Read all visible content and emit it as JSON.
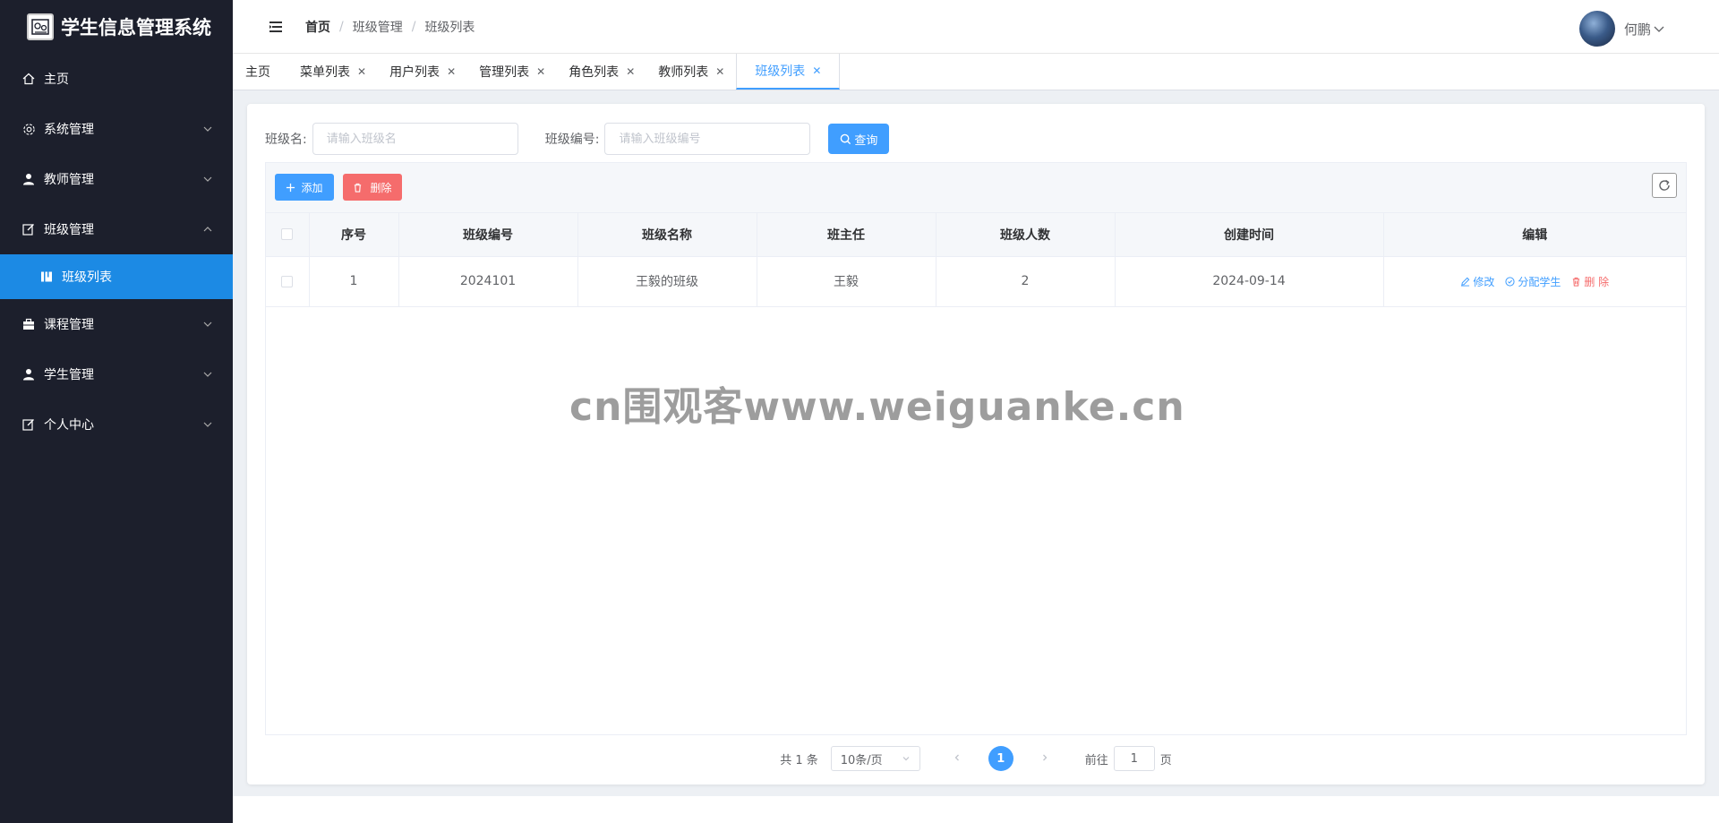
{
  "app": {
    "title": "学生信息管理系统"
  },
  "sidebar": {
    "items": [
      {
        "label": "主页",
        "icon": "home-icon"
      },
      {
        "label": "系统管理",
        "icon": "gear-icon"
      },
      {
        "label": "教师管理",
        "icon": "user-icon"
      },
      {
        "label": "班级管理",
        "icon": "edit-icon",
        "expanded": true
      },
      {
        "label": "课程管理",
        "icon": "briefcase-icon"
      },
      {
        "label": "学生管理",
        "icon": "user-icon"
      },
      {
        "label": "个人中心",
        "icon": "edit-icon"
      }
    ],
    "sub_items": [
      {
        "label": "班级列表",
        "icon": "book-icon",
        "active": true
      }
    ],
    "active_color": "#1c8ae4",
    "bg_color": "#1c1f2c"
  },
  "header": {
    "breadcrumb": [
      "首页",
      "班级管理",
      "班级列表"
    ],
    "user_name": "何鹏"
  },
  "tabs": [
    {
      "label": "主页"
    },
    {
      "label": "菜单列表"
    },
    {
      "label": "用户列表"
    },
    {
      "label": "管理列表"
    },
    {
      "label": "角色列表"
    },
    {
      "label": "教师列表"
    },
    {
      "label": "班级列表",
      "active": true
    }
  ],
  "search": {
    "class_name_label": "班级名:",
    "class_name_placeholder": "请输入班级名",
    "class_code_label": "班级编号:",
    "class_code_placeholder": "请输入班级编号",
    "query_label": "查询"
  },
  "toolbar": {
    "add_label": "添加",
    "delete_label": "删除"
  },
  "table": {
    "columns": [
      "序号",
      "班级编号",
      "班级名称",
      "班主任",
      "班级人数",
      "创建时间",
      "编辑"
    ],
    "rows": [
      {
        "index": "1",
        "code": "2024101",
        "name": "王毅的班级",
        "teacher": "王毅",
        "count": "2",
        "created": "2024-09-14"
      }
    ],
    "actions": {
      "edit": "修改",
      "assign": "分配学生",
      "delete": "删 除"
    }
  },
  "watermark": "cn围观客www.weiguanke.cn",
  "pagination": {
    "total": "共 1 条",
    "page_size": "10条/页",
    "current_page": "1",
    "goto_prefix": "前往",
    "goto_value": "1",
    "goto_suffix": "页"
  },
  "colors": {
    "primary": "#409eff",
    "danger": "#f56c6c"
  }
}
